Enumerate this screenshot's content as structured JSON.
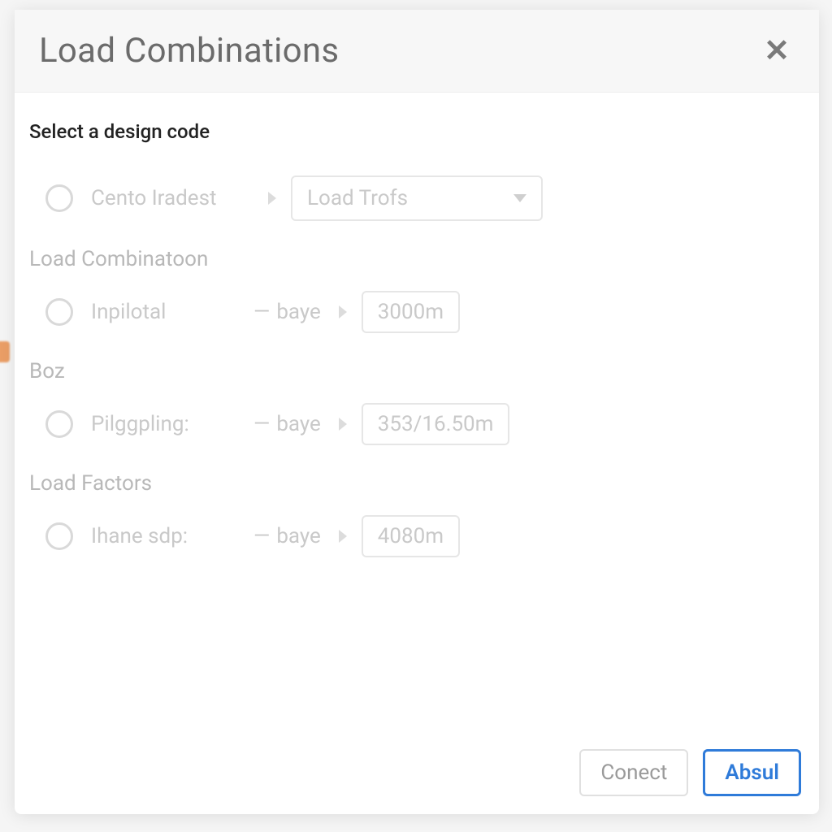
{
  "modal": {
    "title": "Load Combinations",
    "close_glyph": "✕",
    "prompt": "Select a design code",
    "design_code": {
      "option_label": "Cento Iradest",
      "dropdown_value": "Load Trofs"
    },
    "sections": {
      "load_combination": {
        "heading": "Load Combinatoon",
        "item": {
          "label": "Inpilotal",
          "mid": "baye",
          "value": "3000m"
        }
      },
      "boz": {
        "heading": "Boz",
        "item": {
          "label": "Pilggpling:",
          "mid": "baye",
          "value": "353/16.50m"
        }
      },
      "load_factors": {
        "heading": "Load Factors",
        "item": {
          "label": "Ihane sdp:",
          "mid": "baye",
          "value": "4080m"
        }
      }
    },
    "footer": {
      "secondary_label": "Conect",
      "primary_label": "Absul"
    }
  }
}
